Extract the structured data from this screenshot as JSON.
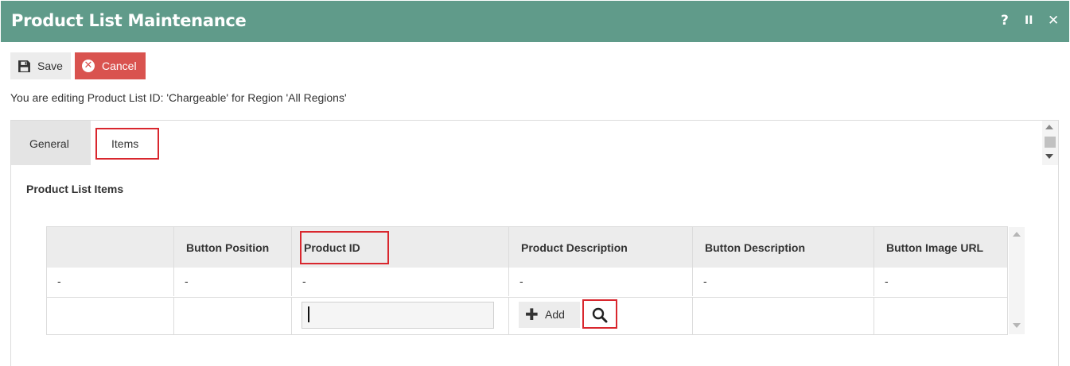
{
  "window": {
    "title": "Product List Maintenance",
    "help_icon": "?",
    "pause_icon": "II",
    "close_icon": "✕",
    "titlebar_color": "#609b8a"
  },
  "toolbar": {
    "save_label": "Save",
    "cancel_label": "Cancel"
  },
  "editing_message": "You are editing Product List ID: 'Chargeable' for Region 'All Regions'",
  "tabs": [
    {
      "label": "General",
      "active": false
    },
    {
      "label": "Items",
      "active": true
    }
  ],
  "section_title": "Product List Items",
  "grid": {
    "columns": [
      "",
      "Button Position",
      "Product ID",
      "Product Description",
      "Button Description",
      "Button Image URL"
    ],
    "rows": [
      [
        "-",
        "-",
        "-",
        "-",
        "-",
        "-"
      ]
    ],
    "new_row": {
      "product_id_value": "",
      "add_label": "Add"
    }
  },
  "colors": {
    "accent_red": "#d9534f",
    "highlight_red": "#d9272e"
  }
}
